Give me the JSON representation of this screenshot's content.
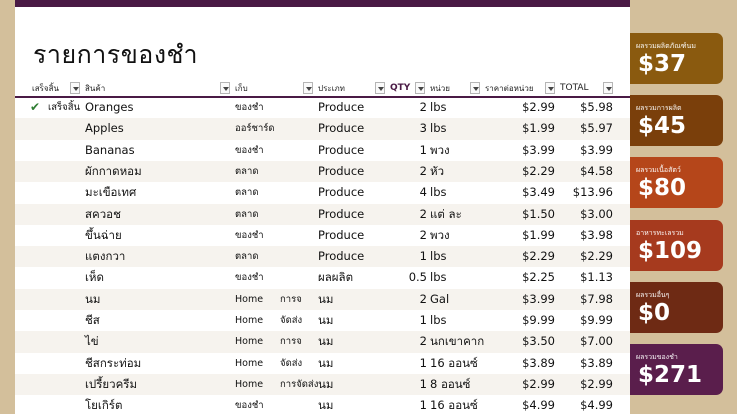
{
  "title": "รายการของชำ",
  "headers": {
    "done": "เสร็จสิ้น",
    "item": "สินค้า",
    "store": "เก็บ",
    "category": "ประเภท",
    "qty": "QTY",
    "unit": "หน่วย",
    "unit_price": "ราคาต่อหน่วย",
    "total": "TOTAL"
  },
  "rows": [
    {
      "done": "เสร็จสิ้น",
      "item": "Oranges",
      "store": "ของชำ",
      "subcat": "",
      "category": "Produce",
      "qty": "2",
      "unit": "lbs",
      "price": "$2.99",
      "total": "$5.98"
    },
    {
      "done": "",
      "item": "Apples",
      "store": "ออร์ชาร์ด",
      "subcat": "",
      "category": "Produce",
      "qty": "3",
      "unit": "lbs",
      "price": "$1.99",
      "total": "$5.97"
    },
    {
      "done": "",
      "item": "Bananas",
      "store": "ของชำ",
      "subcat": "",
      "category": "Produce",
      "qty": "1",
      "unit": "พวง",
      "price": "$3.99",
      "total": "$3.99"
    },
    {
      "done": "",
      "item": "ผักกาดหอม",
      "store": "ตลาด",
      "subcat": "",
      "category": "Produce",
      "qty": "2",
      "unit": "หัว",
      "price": "$2.29",
      "total": "$4.58"
    },
    {
      "done": "",
      "item": "มะเขือเทศ",
      "store": "ตลาด",
      "subcat": "",
      "category": "Produce",
      "qty": "4",
      "unit": "lbs",
      "price": "$3.49",
      "total": "$13.96"
    },
    {
      "done": "",
      "item": "สควอช",
      "store": "ตลาด",
      "subcat": "",
      "category": "Produce",
      "qty": "2",
      "unit": "แต่ ละ",
      "price": "$1.50",
      "total": "$3.00"
    },
    {
      "done": "",
      "item": "ขึ้นฉ่าย",
      "store": "ของชำ",
      "subcat": "",
      "category": "Produce",
      "qty": "2",
      "unit": "พวง",
      "price": "$1.99",
      "total": "$3.98"
    },
    {
      "done": "",
      "item": "แตงกวา",
      "store": "ตลาด",
      "subcat": "",
      "category": "Produce",
      "qty": "1",
      "unit": "lbs",
      "price": "$2.29",
      "total": "$2.29"
    },
    {
      "done": "",
      "item": "เห็ด",
      "store": "ของชำ",
      "subcat": "",
      "category": "ผลผลิต",
      "qty": "0.5",
      "unit": "lbs",
      "price": "$2.25",
      "total": "$1.13"
    },
    {
      "done": "",
      "item": "นม",
      "store": "Home",
      "subcat": "การจ",
      "category": "นม",
      "qty": "2",
      "unit": "Gal",
      "price": "$3.99",
      "total": "$7.98"
    },
    {
      "done": "",
      "item": "ชีส",
      "store": "Home",
      "subcat": "จัดส่ง",
      "category": "นม",
      "qty": "1",
      "unit": "lbs",
      "price": "$9.99",
      "total": "$9.99"
    },
    {
      "done": "",
      "item": "ไข่",
      "store": "Home",
      "subcat": "การจ",
      "category": "นม",
      "qty": "2",
      "unit": "นกเขาคาก",
      "price": "$3.50",
      "total": "$7.00"
    },
    {
      "done": "",
      "item": "ชีสกระท่อม",
      "store": "Home",
      "subcat": "จัดส่ง",
      "category": "นม",
      "qty": "1",
      "unit": "16 ออนซ์",
      "price": "$3.89",
      "total": "$3.89"
    },
    {
      "done": "",
      "item": "เปรี้ยวครีม",
      "store": "Home",
      "subcat": "การจัดส่ง",
      "category": "นม",
      "qty": "1",
      "unit": "8 ออนซ์",
      "price": "$2.99",
      "total": "$2.99"
    },
    {
      "done": "",
      "item": "โยเกิร์ต",
      "store": "ของชำ",
      "subcat": "",
      "category": "นม",
      "qty": "1",
      "unit": "16 ออนซ์",
      "price": "$4.99",
      "total": "$4.99"
    }
  ],
  "tiles": [
    {
      "label": "ผลรวมผลิตภัณฑ์นม",
      "value": "$37",
      "color": "#8a5a0f"
    },
    {
      "label": "ผลรวมการผลิต",
      "value": "$45",
      "color": "#7a3f0b"
    },
    {
      "label": "ผลรวมเนื้อสัตว์",
      "value": "$80",
      "color": "#b5461a"
    },
    {
      "label": "อาหารทะเลรวม",
      "value": "$109",
      "color": "#a63a1e"
    },
    {
      "label": "ผลรวมอื่นๆ",
      "value": "$0",
      "color": "#6e2a14"
    },
    {
      "label": "ผลรวมของชำ",
      "value": "$271",
      "color": "#5a1e4c"
    }
  ]
}
